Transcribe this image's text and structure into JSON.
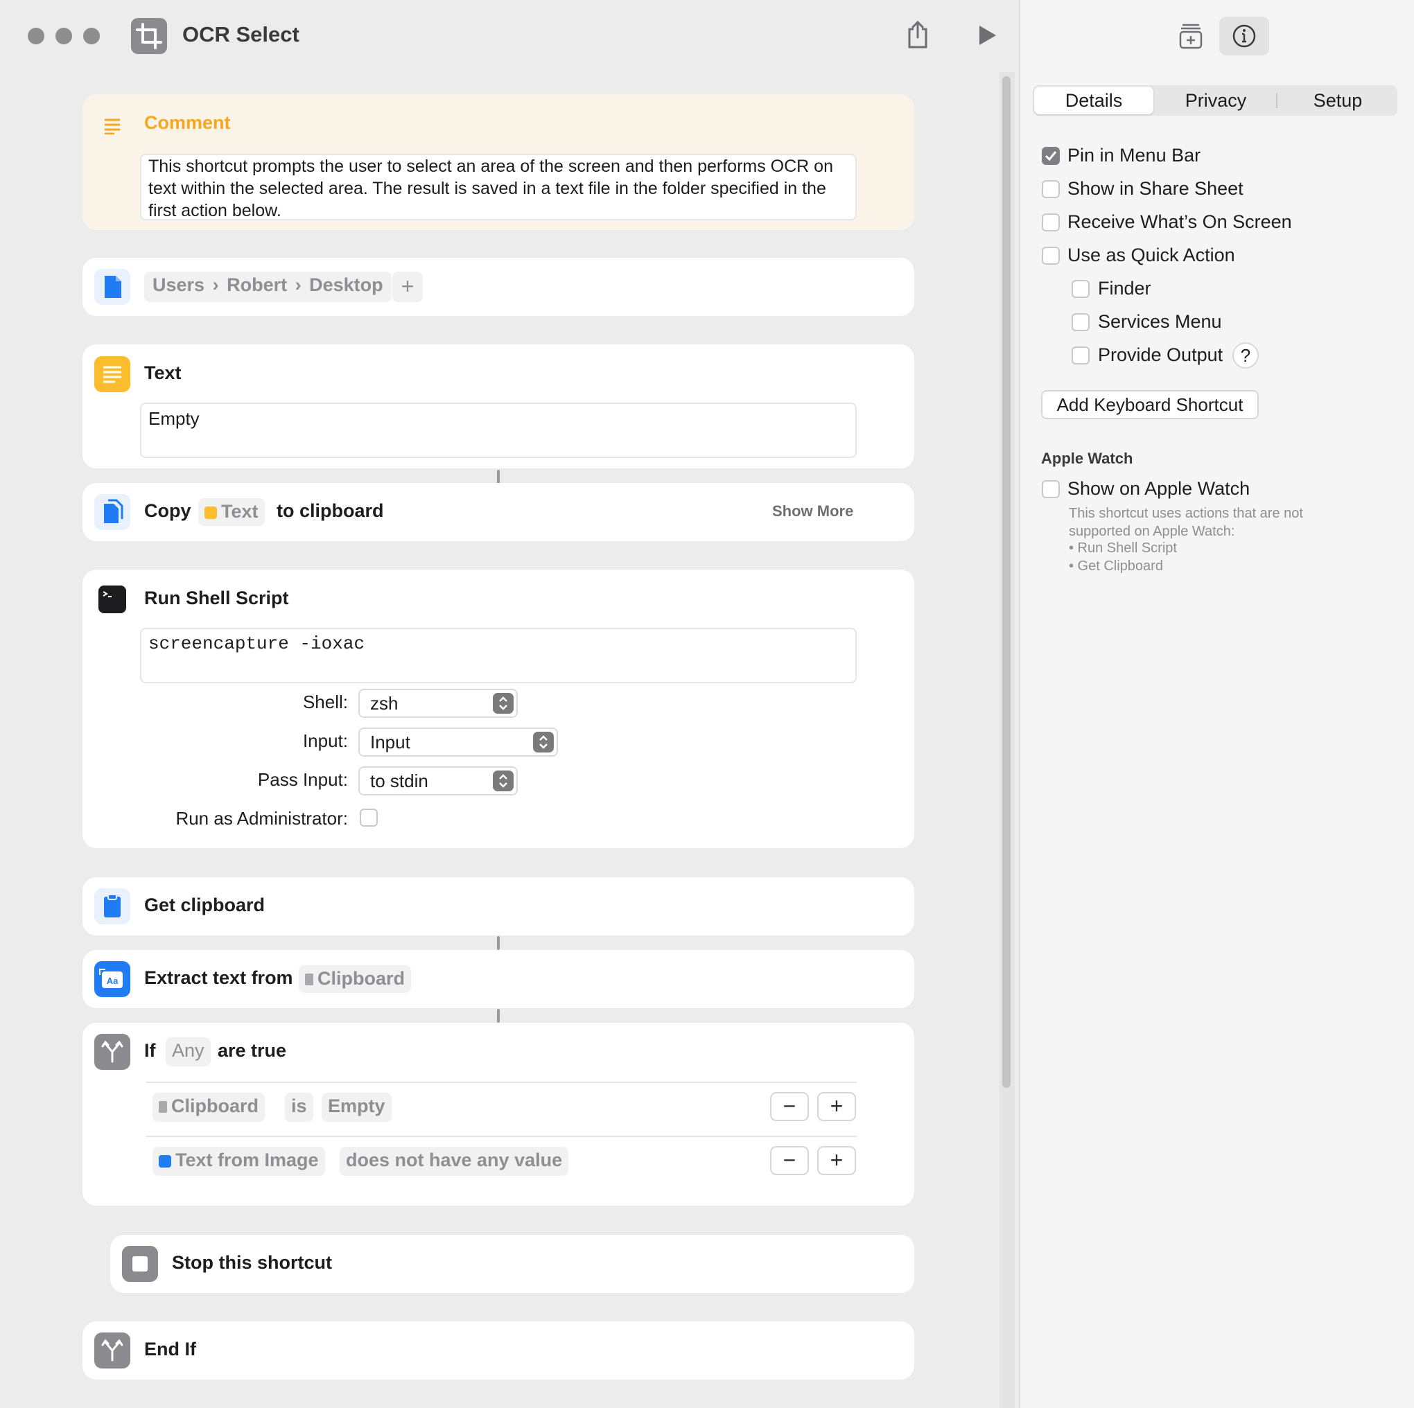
{
  "window": {
    "title": "OCR Select",
    "share_icon": "share-icon",
    "run_icon": "play-icon"
  },
  "actions": {
    "comment": {
      "label": "Comment",
      "text": "This shortcut prompts the user to select an area of the screen and then performs OCR on text within the selected area. The result is saved in a text file in the folder specified in the first action below."
    },
    "folder": {
      "path": [
        "Users",
        "Robert",
        "Desktop"
      ]
    },
    "text": {
      "label": "Text",
      "value": "Empty"
    },
    "copy": {
      "label": "Copy",
      "token": "Text",
      "suffix": "to clipboard",
      "show_more": "Show More"
    },
    "shell": {
      "label": "Run Shell Script",
      "script": "screencapture -ioxac",
      "shell_label": "Shell:",
      "shell_value": "zsh",
      "input_label": "Input:",
      "input_value": "Input",
      "pass_label": "Pass Input:",
      "pass_value": "to stdin",
      "admin_label": "Run as Administrator:",
      "admin_checked": false
    },
    "get_clipboard": {
      "label": "Get clipboard"
    },
    "extract": {
      "label": "Extract text from",
      "token": "Clipboard"
    },
    "if": {
      "label": "If",
      "mode": "Any",
      "suffix": "are true",
      "conditions": [
        {
          "subject": "Clipboard",
          "operator": "is",
          "value": "Empty"
        },
        {
          "subject": "Text from Image",
          "operator": "does not have any value",
          "value": ""
        }
      ]
    },
    "stop": {
      "label": "Stop this shortcut"
    },
    "end_if": {
      "label": "End If"
    }
  },
  "sidebar": {
    "tabs": [
      "Details",
      "Privacy",
      "Setup"
    ],
    "selected_tab": "Details",
    "options": [
      {
        "label": "Pin in Menu Bar",
        "checked": true
      },
      {
        "label": "Show in Share Sheet",
        "checked": false
      },
      {
        "label": "Receive What’s On Screen",
        "checked": false
      },
      {
        "label": "Use as Quick Action",
        "checked": false
      }
    ],
    "quick_action_options": [
      {
        "label": "Finder",
        "checked": false
      },
      {
        "label": "Services Menu",
        "checked": false
      },
      {
        "label": "Provide Output",
        "checked": false
      }
    ],
    "help": "?",
    "keyboard_shortcut_button": "Add Keyboard Shortcut",
    "apple_watch": {
      "heading": "Apple Watch",
      "option": "Show on Apple Watch",
      "checked": false,
      "note": "This shortcut uses actions that are not supported on Apple Watch:",
      "unsupported": [
        "• Run Shell Script",
        "• Get Clipboard"
      ]
    }
  },
  "colors": {
    "accent_blue": "#1f7cf2",
    "comment_orange": "#f5a623",
    "text_yellow": "#fbbc2e",
    "control_gray": "#8a8a8f"
  }
}
